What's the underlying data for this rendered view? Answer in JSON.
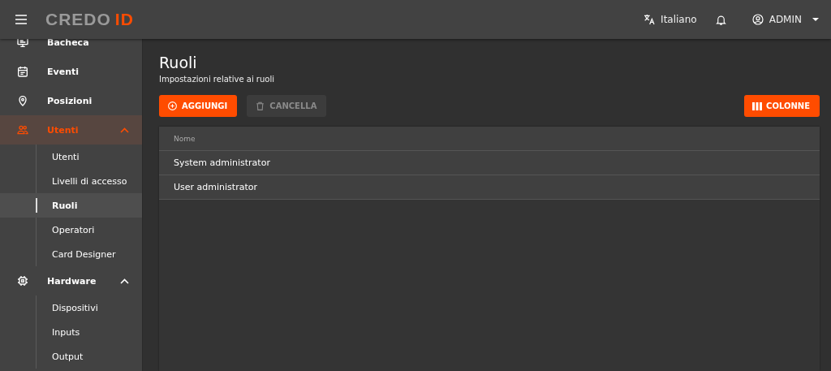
{
  "header": {
    "logo": {
      "main": "CREDO",
      "accent": "ID"
    },
    "language": "Italiano",
    "user": "ADMIN"
  },
  "sidebar": {
    "items": [
      {
        "label": "Bacheca",
        "selected": false
      },
      {
        "label": "Eventi",
        "selected": false
      },
      {
        "label": "Posizioni",
        "selected": false
      },
      {
        "label": "Utenti",
        "selected": true,
        "expanded": true,
        "children": [
          {
            "label": "Utenti",
            "selected": false
          },
          {
            "label": "Livelli di accesso",
            "selected": false
          },
          {
            "label": "Ruoli",
            "selected": true
          },
          {
            "label": "Operatori",
            "selected": false
          },
          {
            "label": "Card Designer",
            "selected": false
          }
        ]
      },
      {
        "label": "Hardware",
        "selected": false,
        "expanded": true,
        "children": [
          {
            "label": "Dispositivi",
            "selected": false
          },
          {
            "label": "Inputs",
            "selected": false
          },
          {
            "label": "Output",
            "selected": false
          }
        ]
      }
    ]
  },
  "page": {
    "title": "Ruoli",
    "subtitle": "Impostazioni relative ai ruoli"
  },
  "toolbar": {
    "buttons": [
      {
        "label": "AGGIUNGI",
        "disabled": false
      },
      {
        "label": "CANCELLA",
        "disabled": true
      }
    ],
    "columns_button": "COLONNE"
  },
  "table": {
    "columns": [
      "Nome"
    ],
    "rows": [
      [
        "System administrator"
      ],
      [
        "User administrator"
      ]
    ]
  }
}
